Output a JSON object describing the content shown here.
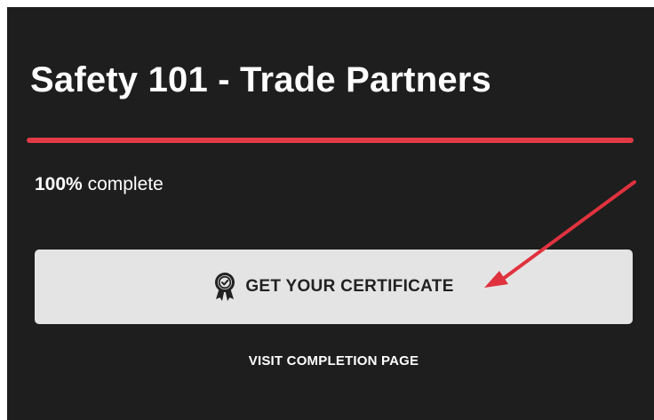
{
  "course": {
    "title": "Safety 101 - Trade Partners"
  },
  "progress": {
    "percent": 100,
    "percent_label": "100%",
    "suffix": "complete",
    "bar_color": "#e23a47"
  },
  "actions": {
    "certificate_label": "GET YOUR CERTIFICATE",
    "certificate_icon": "award-ribbon-icon",
    "completion_label": "VISIT COMPLETION PAGE"
  },
  "annotation": {
    "arrow_color": "#e0323e"
  },
  "theme": {
    "panel_bg": "#1e1e1e",
    "button_bg": "#e4e4e4"
  }
}
